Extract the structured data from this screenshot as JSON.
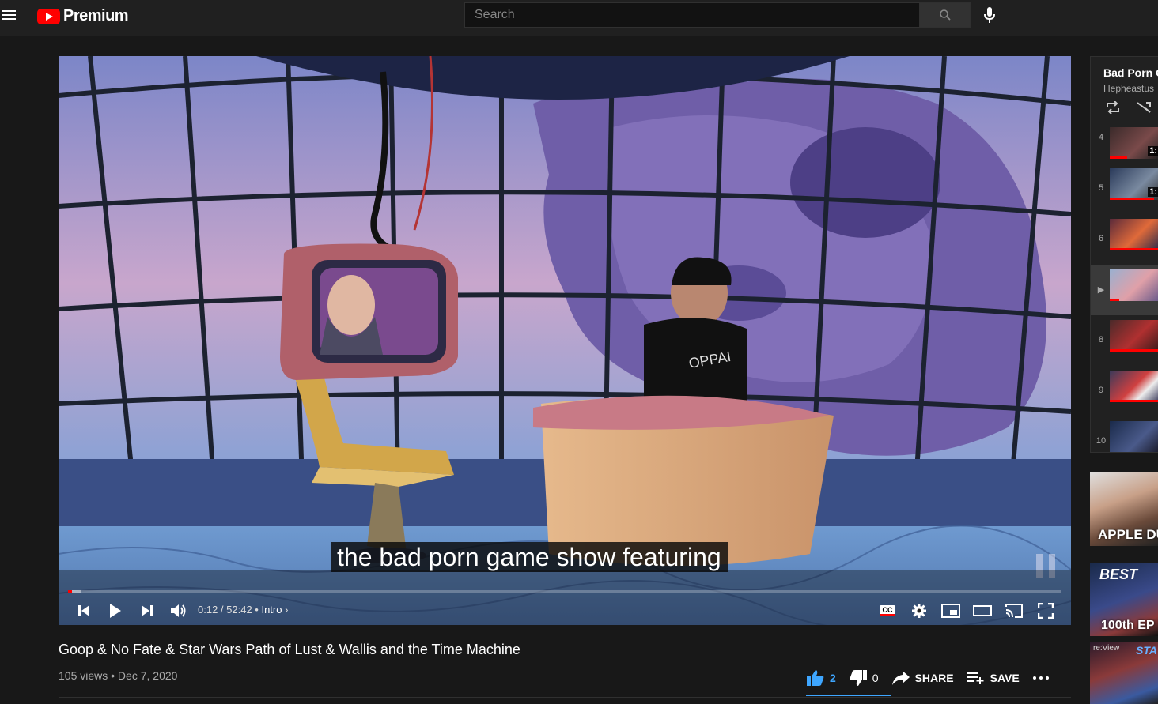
{
  "header": {
    "logo_text": "Premium",
    "search_placeholder": "Search",
    "brand_color": "#ff0000"
  },
  "player": {
    "caption": "the bad porn game show featuring",
    "time": "0:12 / 52:42",
    "chapter": "Intro",
    "progress_fraction": 0.004,
    "buffered_fraction": 0.013,
    "cc_badge": "CC"
  },
  "video": {
    "title": "Goop & No Fate & Star Wars Path of Lust & Wallis and the Time Machine",
    "meta": "105 views • Dec 7, 2020",
    "likes": "2",
    "dislikes": "0",
    "share_label": "SHARE",
    "save_label": "SAVE"
  },
  "playlist": {
    "title": "Bad Porn G",
    "owner": "Hepheastus",
    "items": [
      {
        "index": "4",
        "duration": "1:"
      },
      {
        "index": "5",
        "duration": "1:"
      },
      {
        "index": "6",
        "duration": ""
      },
      {
        "index": "▶",
        "duration": ""
      },
      {
        "index": "8",
        "duration": ""
      },
      {
        "index": "9",
        "duration": ""
      },
      {
        "index": "10",
        "duration": ""
      }
    ]
  },
  "recommendations": [
    {
      "label": "APPLE DU"
    },
    {
      "label": "BEST",
      "label2": "100th EP"
    },
    {
      "label": "re:View",
      "label2": "STA"
    }
  ]
}
